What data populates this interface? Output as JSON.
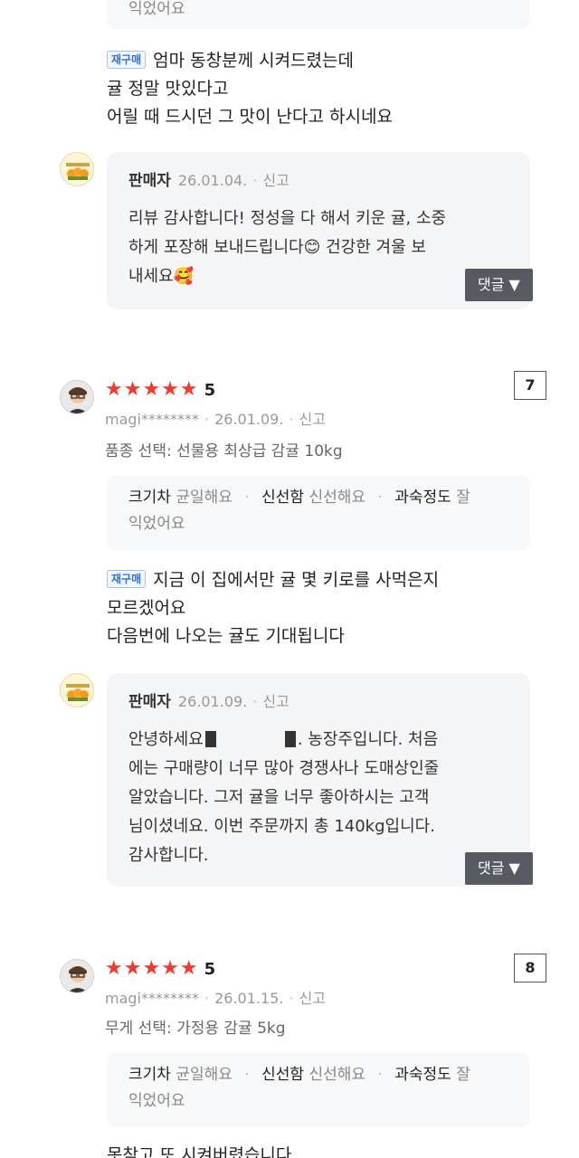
{
  "top_fragment": {
    "text": "익었어요"
  },
  "review_a": {
    "repurchase_badge": "재구매",
    "text_lines": [
      "엄마 동창분께 시켜드렸는데",
      "귤 정말 맛있다고",
      "어릴 때 드시던 그 맛이 난다고 하시네요"
    ],
    "reply": {
      "name": "판매자",
      "date": "26.01.04.",
      "report": "신고",
      "lines": [
        "리뷰 감사합니다! 정성을 다 해서 키운 귤, 소중",
        "하게 포장해 보내드립니다",
        "건강한 겨울 보",
        "내세요"
      ],
      "emoji_1": "😊",
      "emoji_2": "🥰",
      "comment_label": "댓글 ▼"
    }
  },
  "review_7": {
    "index": "7",
    "stars": "★★★★★",
    "score": "5",
    "user": "magi********",
    "date": "26.01.09.",
    "report": "신고",
    "option": "품종 선택: 선물용 최상급 감귤 10kg",
    "attrs": {
      "k1": "크기차",
      "v1": "균일해요",
      "k2": "신선함",
      "v2": "신선해요",
      "k3": "과숙정도",
      "v3a": "잘",
      "v3b": "익었어요"
    },
    "repurchase_badge": "재구매",
    "text_lines": [
      "지금 이 집에서만 귤 몇 키로를 사먹은지",
      "모르겠어요",
      "다음번에 나오는 귤도 기대됩니다"
    ],
    "reply": {
      "name": "판매자",
      "date": "26.01.09.",
      "report": "신고",
      "line1_a": "안녕하세요",
      "line1_b": ". 농장주입니다. 처음",
      "lines": [
        "에는 구매량이 너무 많아 경쟁사나 도매상인줄",
        "알았습니다. 그저 귤을 너무 좋아하시는 고객",
        "님이셨네요. 이번 주문까지 총 140kg입니다.",
        "감사합니다."
      ],
      "comment_label": "댓글 ▼"
    }
  },
  "review_8": {
    "index": "8",
    "stars": "★★★★★",
    "score": "5",
    "user": "magi********",
    "date": "26.01.15.",
    "report": "신고",
    "option": "무게 선택: 가정용 감귤 5kg",
    "attrs": {
      "k1": "크기차",
      "v1": "균일해요",
      "k2": "신선함",
      "v2": "신선해요",
      "k3": "과숙정도",
      "v3a": "잘",
      "v3b": "익었어요"
    },
    "text_partial": "못참고 또 시켜버렸습니다"
  },
  "icons": {
    "seller_logo": "seller-logo-icon",
    "avatar": "user-avatar-icon",
    "star": "star-icon",
    "dropdown": "chevron-down-icon"
  },
  "colors": {
    "star": "#ee3b2b",
    "badge_text": "#2f6fd0",
    "badge_border": "#9ec3f0",
    "button_bg": "#555b61",
    "reply_bg": "#f4f5f7"
  }
}
